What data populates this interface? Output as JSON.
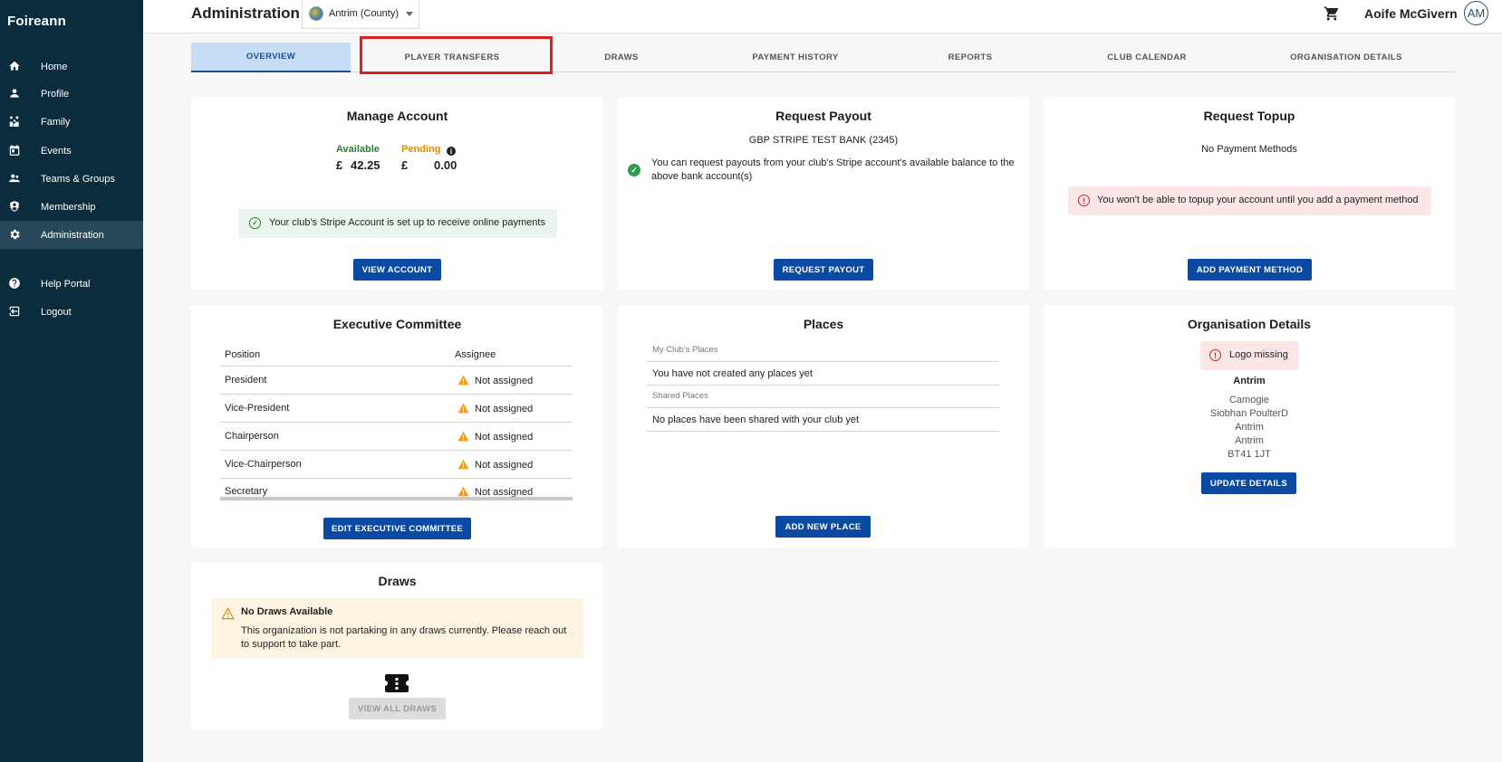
{
  "brand": "Foireann",
  "sidebar": {
    "items": [
      {
        "label": "Home",
        "icon": "home-icon"
      },
      {
        "label": "Profile",
        "icon": "person-icon"
      },
      {
        "label": "Family",
        "icon": "family-icon"
      },
      {
        "label": "Events",
        "icon": "calendar-icon"
      },
      {
        "label": "Teams & Groups",
        "icon": "group-icon"
      },
      {
        "label": "Membership",
        "icon": "shield-icon"
      },
      {
        "label": "Administration",
        "icon": "gear-icon",
        "active": true
      },
      {
        "label": "Help Portal",
        "icon": "help-icon"
      },
      {
        "label": "Logout",
        "icon": "logout-icon"
      }
    ]
  },
  "header": {
    "title": "Administration",
    "org_select": "Antrim (County)",
    "user_name": "Aoife McGivern",
    "avatar_initials": "AM"
  },
  "tabs": [
    {
      "label": "OVERVIEW",
      "active": true
    },
    {
      "label": "PLAYER TRANSFERS"
    },
    {
      "label": "DRAWS"
    },
    {
      "label": "PAYMENT HISTORY"
    },
    {
      "label": "REPORTS"
    },
    {
      "label": "CLUB CALENDAR"
    },
    {
      "label": "ORGANISATION DETAILS"
    }
  ],
  "manage_account": {
    "title": "Manage Account",
    "available_label": "Available",
    "pending_label": "Pending",
    "currency": "£",
    "available_value": "42.25",
    "pending_value": "0.00",
    "stripe_msg": "Your club's Stripe Account is set up to receive online payments",
    "button": "VIEW ACCOUNT"
  },
  "request_payout": {
    "title": "Request Payout",
    "bank": "GBP STRIPE TEST BANK (2345)",
    "msg_line1": "You can request payouts from your club's Stripe account's available balance to the",
    "msg_line2": "above bank account(s)",
    "button": "REQUEST PAYOUT"
  },
  "request_topup": {
    "title": "Request Topup",
    "no_methods": "No Payment Methods",
    "warning": "You won't be able to topup your account until you add a payment method",
    "button": "ADD PAYMENT METHOD"
  },
  "executive_committee": {
    "title": "Executive Committee",
    "col_position": "Position",
    "col_assignee": "Assignee",
    "rows": [
      {
        "position": "President",
        "assignee": "Not assigned"
      },
      {
        "position": "Vice-President",
        "assignee": "Not assigned"
      },
      {
        "position": "Chairperson",
        "assignee": "Not assigned"
      },
      {
        "position": "Vice-Chairperson",
        "assignee": "Not assigned"
      },
      {
        "position": "Secretary",
        "assignee": "Not assigned"
      }
    ],
    "button": "EDIT EXECUTIVE COMMITTEE"
  },
  "places": {
    "title": "Places",
    "my_label": "My Club's Places",
    "my_empty": "You have not created any places yet",
    "shared_label": "Shared Places",
    "shared_empty": "No places have been shared with your club yet",
    "button": "ADD NEW PLACE"
  },
  "org_details": {
    "title": "Organisation Details",
    "logo_missing": "Logo missing",
    "name": "Antrim",
    "lines": [
      "Camogie",
      "Siobhan PoulterD",
      "Antrim",
      "Antrim",
      "BT41 1JT"
    ],
    "button": "UPDATE DETAILS"
  },
  "draws": {
    "title": "Draws",
    "alert_title": "No Draws Available",
    "alert_line1": "This organization is not partaking in any draws currently. Please reach out",
    "alert_line2": "to support to take part.",
    "button": "VIEW ALL DRAWS"
  },
  "colors": {
    "sidebar_bg": "#0b2c3d",
    "primary": "#0b4aa2",
    "highlight": "#e11d1d",
    "available": "#2e7d32",
    "pending": "#e08a00"
  }
}
